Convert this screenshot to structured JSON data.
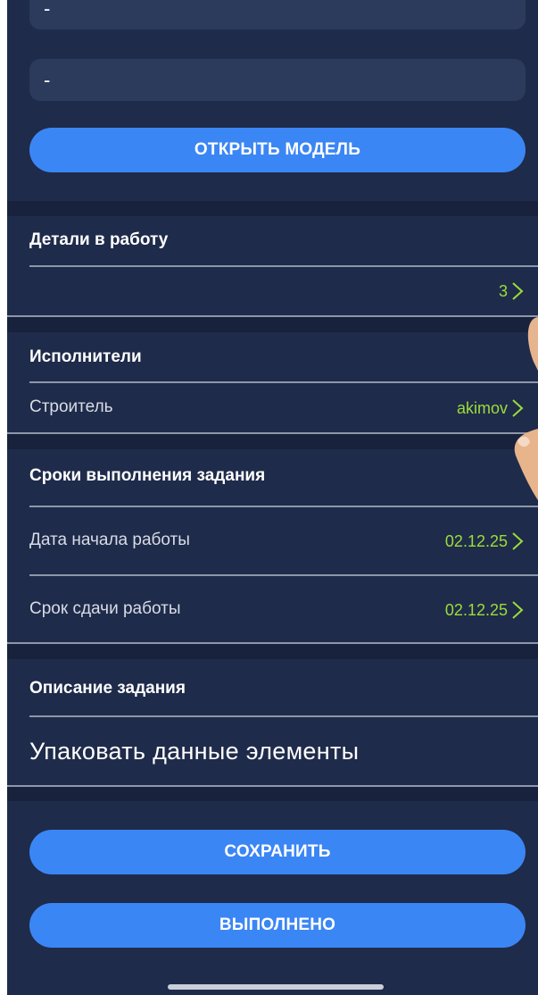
{
  "form": {
    "field1_value": "-",
    "field2_value": "-",
    "open_model_label": "ОТКРЫТЬ МОДЕЛЬ"
  },
  "parts": {
    "heading": "Детали в работу",
    "count": "3"
  },
  "performers": {
    "heading": "Исполнители",
    "builder_label": "Строитель",
    "builder_value": "akimov"
  },
  "deadlines": {
    "heading": "Сроки выполнения задания",
    "start_label": "Дата начала работы",
    "start_value": "02.12.25",
    "due_label": "Срок сдачи работы",
    "due_value": "02.12.25"
  },
  "description": {
    "heading": "Описание задания",
    "text": "Упаковать данные элементы"
  },
  "actions": {
    "save_label": "СОХРАНИТЬ",
    "done_label": "ВЫПОЛНЕНО"
  },
  "icons": {
    "chevron": "chevron-right-icon"
  },
  "colors": {
    "background": "#1f2b4a",
    "accent_button": "#3b86f5",
    "value_green": "#9bdd3a"
  }
}
